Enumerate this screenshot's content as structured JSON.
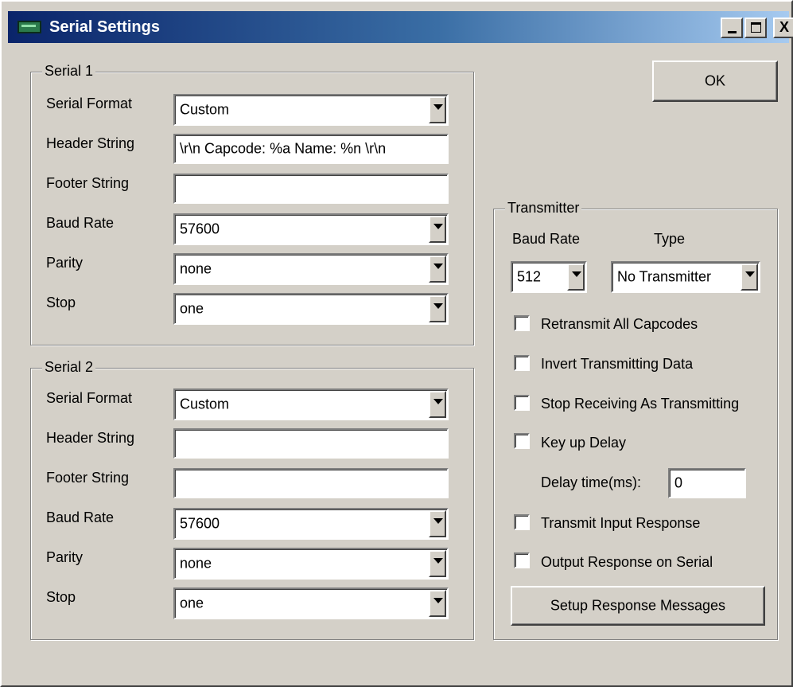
{
  "window": {
    "title": "Serial Settings",
    "icon": "app-window-icon"
  },
  "title_buttons": {
    "minimize": "_",
    "close": "X"
  },
  "ok_button": "OK",
  "serial1": {
    "legend": "Serial 1",
    "serial_format": {
      "label": "Serial Format",
      "value": "Custom"
    },
    "header_string": {
      "label": "Header String",
      "value": "\\r\\n Capcode: %a Name: %n \\r\\n"
    },
    "footer_string": {
      "label": "Footer String",
      "value": ""
    },
    "baud_rate": {
      "label": "Baud Rate",
      "value": "57600"
    },
    "parity": {
      "label": "Parity",
      "value": "none"
    },
    "stop": {
      "label": "Stop",
      "value": "one"
    }
  },
  "serial2": {
    "legend": "Serial 2",
    "serial_format": {
      "label": "Serial Format",
      "value": "Custom"
    },
    "header_string": {
      "label": "Header String",
      "value": ""
    },
    "footer_string": {
      "label": "Footer String",
      "value": ""
    },
    "baud_rate": {
      "label": "Baud Rate",
      "value": "57600"
    },
    "parity": {
      "label": "Parity",
      "value": "none"
    },
    "stop": {
      "label": "Stop",
      "value": "one"
    }
  },
  "transmitter": {
    "legend": "Transmitter",
    "baud_rate_label": "Baud Rate",
    "baud_rate_value": "512",
    "type_label": "Type",
    "type_value": "No Transmitter",
    "checkboxes": [
      {
        "label": "Retransmit All Capcodes",
        "checked": false
      },
      {
        "label": "Invert Transmitting Data",
        "checked": false
      },
      {
        "label": "Stop Receiving As Transmitting",
        "checked": false
      },
      {
        "label": "Key up Delay",
        "checked": false
      },
      {
        "label": "Transmit Input Response",
        "checked": false
      },
      {
        "label": "Output Response on Serial",
        "checked": false
      }
    ],
    "delay_label": "Delay time(ms):",
    "delay_value": "0",
    "setup_button": "Setup Response Messages"
  }
}
